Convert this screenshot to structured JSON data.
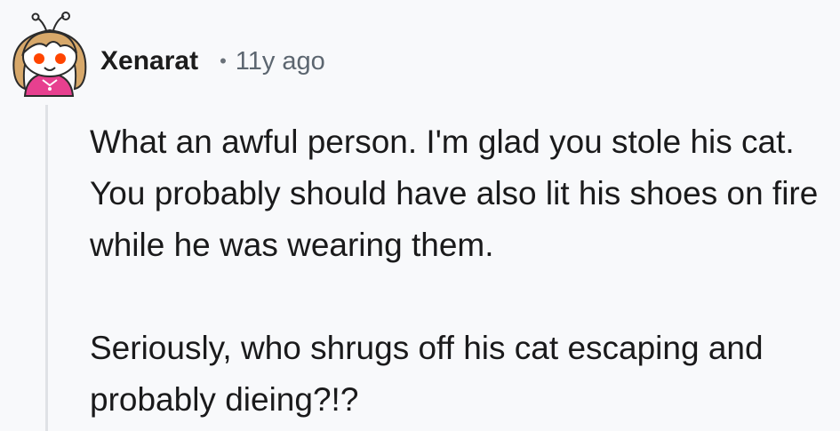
{
  "comment": {
    "author": "Xenarat",
    "separator": "•",
    "timestamp": "11y ago",
    "avatar_icon": "snoo-avatar-icon",
    "paragraphs": [
      "What an awful person. I'm glad you stole his cat. You probably should have also lit his shoes on fire while he was wearing them.",
      "Seriously, who shrugs off his cat escaping and probably dieing?!?"
    ]
  }
}
